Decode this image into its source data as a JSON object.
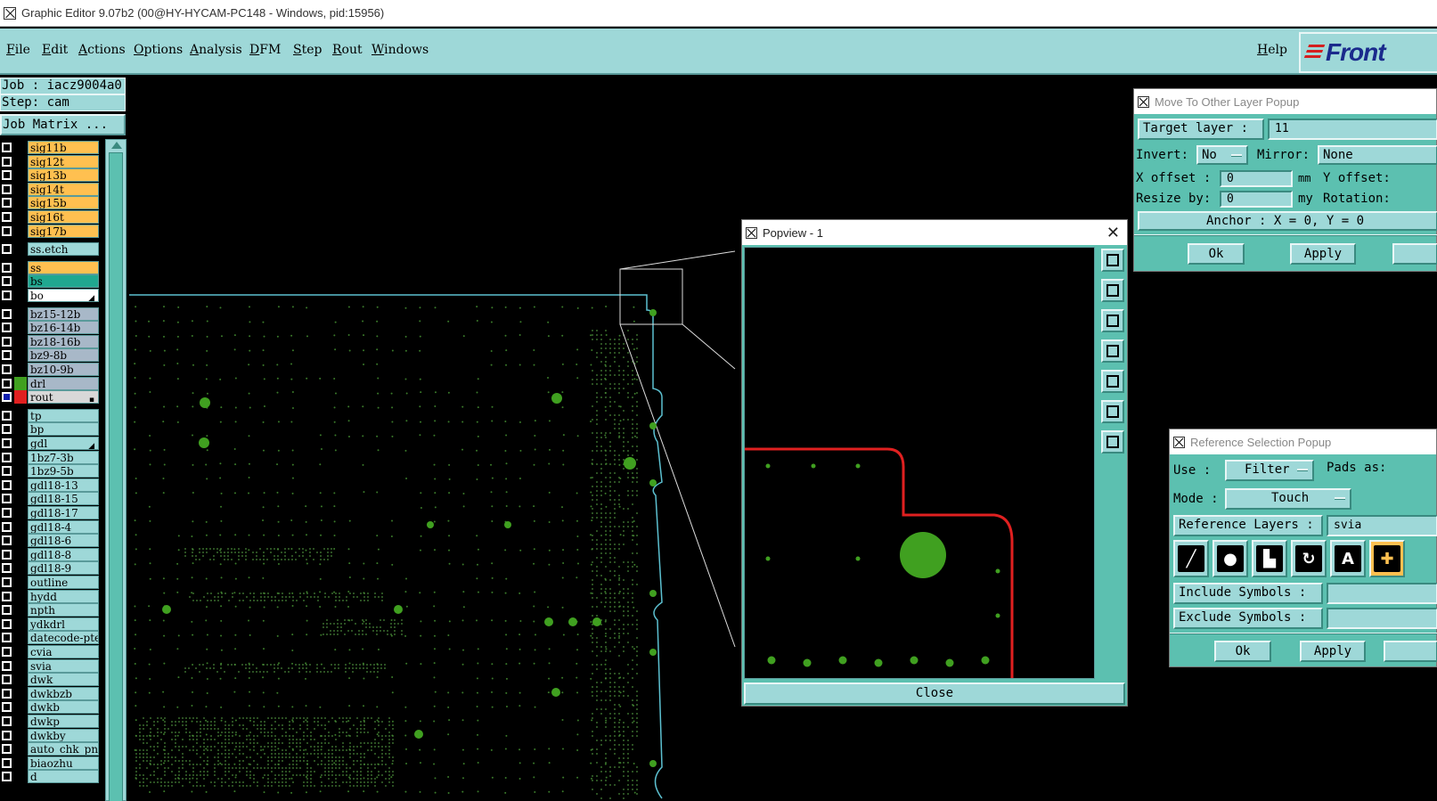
{
  "window": {
    "title": "Graphic Editor 9.07b2 (00@HY-HYCAM-PC148 - Windows, pid:15956)"
  },
  "menu": {
    "items": [
      "File",
      "Edit",
      "Actions",
      "Options",
      "Analysis",
      "DFM",
      "Step",
      "Rout",
      "Windows"
    ],
    "help": "Help",
    "brand": "Front"
  },
  "job": {
    "job_label": "Job : iacz9004a0",
    "step_label": "Step: cam",
    "matrix_button": "Job Matrix ..."
  },
  "layers": [
    {
      "name": "sig11b",
      "color": "#ffc050",
      "gap": false
    },
    {
      "name": "sig12t",
      "color": "#ffc050"
    },
    {
      "name": "sig13b",
      "color": "#ffc050"
    },
    {
      "name": "sig14t",
      "color": "#ffc050"
    },
    {
      "name": "sig15b",
      "color": "#ffc050"
    },
    {
      "name": "sig16t",
      "color": "#ffc050"
    },
    {
      "name": "sig17b",
      "color": "#ffc050"
    },
    {
      "name": "ss.etch",
      "color": "#9ed8d8",
      "gap": true
    },
    {
      "name": "ss",
      "color": "#ffc050",
      "gap": true
    },
    {
      "name": "bs",
      "color": "#20a890"
    },
    {
      "name": "bo",
      "color": "#ffffff",
      "mark": "arrow"
    },
    {
      "name": "bz15-12b",
      "color": "#a8b8c8",
      "gap": true
    },
    {
      "name": "bz16-14b",
      "color": "#a8b8c8"
    },
    {
      "name": "bz18-16b",
      "color": "#a8b8c8"
    },
    {
      "name": "bz9-8b",
      "color": "#a8b8c8"
    },
    {
      "name": "bz10-9b",
      "color": "#a8b8c8"
    },
    {
      "name": "drl",
      "color": "#a8b8c8",
      "swatch": "#40a020"
    },
    {
      "name": "rout",
      "color": "#d8d8d8",
      "swatch": "#e02020",
      "active": true,
      "mark": "box"
    },
    {
      "name": "tp",
      "color": "#9ed8d8",
      "gap": true
    },
    {
      "name": "bp",
      "color": "#9ed8d8"
    },
    {
      "name": "gdl",
      "color": "#9ed8d8",
      "mark": "arrow"
    },
    {
      "name": "1bz7-3b",
      "color": "#9ed8d8"
    },
    {
      "name": "1bz9-5b",
      "color": "#9ed8d8"
    },
    {
      "name": "gdl18-13",
      "color": "#9ed8d8"
    },
    {
      "name": "gdl18-15",
      "color": "#9ed8d8"
    },
    {
      "name": "gdl18-17",
      "color": "#9ed8d8"
    },
    {
      "name": "gdl18-4",
      "color": "#9ed8d8"
    },
    {
      "name": "gdl18-6",
      "color": "#9ed8d8"
    },
    {
      "name": "gdl18-8",
      "color": "#9ed8d8"
    },
    {
      "name": "gdl18-9",
      "color": "#9ed8d8"
    },
    {
      "name": "outline",
      "color": "#9ed8d8"
    },
    {
      "name": "hydd",
      "color": "#9ed8d8"
    },
    {
      "name": "npth",
      "color": "#9ed8d8"
    },
    {
      "name": "ydkdrl",
      "color": "#9ed8d8"
    },
    {
      "name": "datecode-pte",
      "color": "#9ed8d8"
    },
    {
      "name": "cvia",
      "color": "#9ed8d8"
    },
    {
      "name": "svia",
      "color": "#9ed8d8"
    },
    {
      "name": "dwk",
      "color": "#9ed8d8"
    },
    {
      "name": "dwkbzb",
      "color": "#9ed8d8"
    },
    {
      "name": "dwkb",
      "color": "#9ed8d8"
    },
    {
      "name": "dwkp",
      "color": "#9ed8d8"
    },
    {
      "name": "dwkby",
      "color": "#9ed8d8"
    },
    {
      "name": "auto_chk_pn",
      "color": "#9ed8d8"
    },
    {
      "name": "biaozhu",
      "color": "#9ed8d8"
    },
    {
      "name": "d",
      "color": "#9ed8d8"
    }
  ],
  "popview": {
    "title": "Popview - 1",
    "close": "Close"
  },
  "move_popup": {
    "title": "Move To Other Layer Popup",
    "target_label": "Target layer :",
    "target_value": "11",
    "invert_label": "Invert:",
    "invert_value": "No",
    "mirror_label": "Mirror:",
    "mirror_value": "None",
    "xoffset_label": "X offset :",
    "xoffset_value": "0",
    "mm": "mm",
    "yoffset_label": "Y offset:",
    "resize_label": "Resize by:",
    "resize_value": "0",
    "my": "my",
    "rotation_label": "Rotation:",
    "anchor": "Anchor :  X = 0, Y = 0",
    "ok": "Ok",
    "apply": "Apply"
  },
  "ref_popup": {
    "title": "Reference Selection Popup",
    "use_label": "Use  :",
    "use_value": "Filter",
    "pads_label": "Pads as:",
    "mode_label": "Mode :",
    "mode_value": "Touch",
    "ref_layers_label": "Reference Layers :",
    "ref_layers_value": "svia",
    "include_label": "Include Symbols :",
    "exclude_label": "Exclude Symbols :",
    "ok": "Ok",
    "apply": "Apply"
  }
}
